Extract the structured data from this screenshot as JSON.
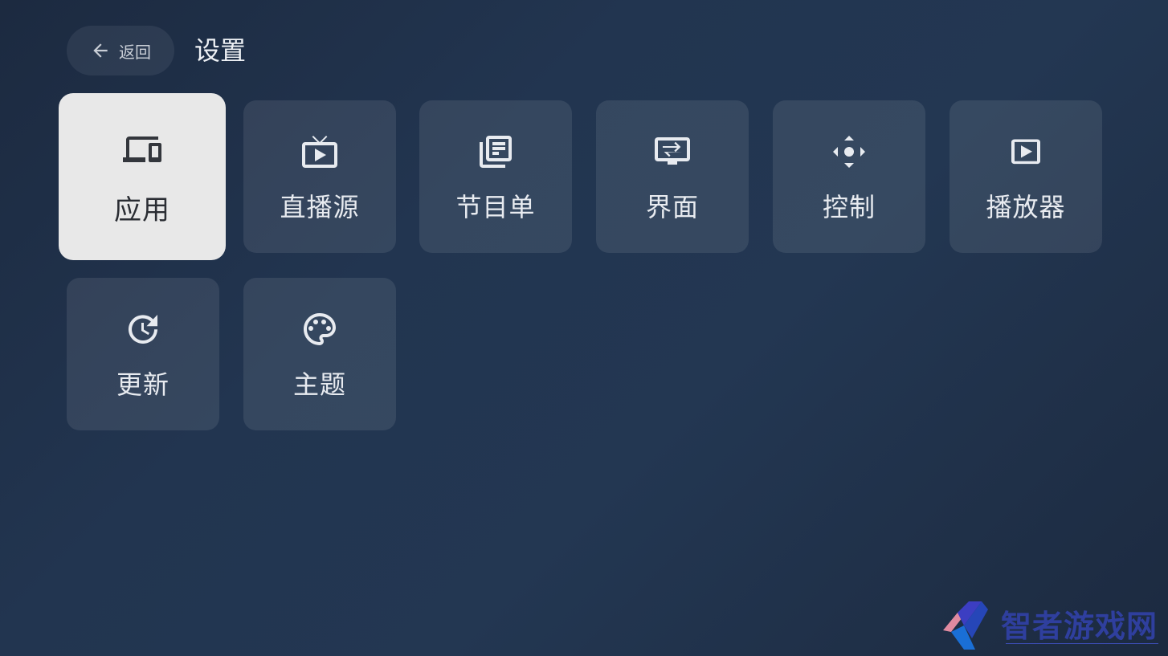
{
  "header": {
    "back_label": "返回",
    "title": "设置"
  },
  "tiles": [
    {
      "label": "应用",
      "icon": "devices-icon",
      "selected": true
    },
    {
      "label": "直播源",
      "icon": "live-tv-icon",
      "selected": false
    },
    {
      "label": "节目单",
      "icon": "library-books-icon",
      "selected": false
    },
    {
      "label": "界面",
      "icon": "screen-settings-icon",
      "selected": false
    },
    {
      "label": "控制",
      "icon": "control-move-icon",
      "selected": false
    },
    {
      "label": "播放器",
      "icon": "play-box-icon",
      "selected": false
    },
    {
      "label": "更新",
      "icon": "update-icon",
      "selected": false
    },
    {
      "label": "主题",
      "icon": "palette-icon",
      "selected": false
    }
  ],
  "watermark": {
    "text": "智者游戏网"
  },
  "colors": {
    "background": "#213350",
    "tile": "#35445b",
    "tile_selected": "#e8e8e8",
    "text": "#e8ebf0",
    "text_selected": "#2a2d33"
  }
}
